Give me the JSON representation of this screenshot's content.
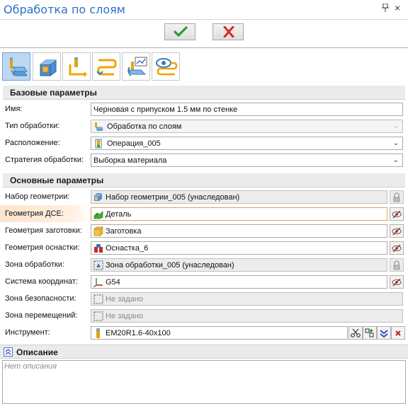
{
  "window": {
    "title": "Обработка по слоям",
    "pin_glyph": "ᵽ",
    "close_glyph": "×"
  },
  "actions": {
    "ok_icon": "checkmark-icon",
    "cancel_icon": "cross-icon",
    "ok_color": "#2e9a2e",
    "cancel_color": "#d62828"
  },
  "toolbar": {
    "buttons": [
      {
        "icon": "layers-mill-icon",
        "active": true
      },
      {
        "icon": "blank-block-icon",
        "active": false
      },
      {
        "icon": "approach-path-icon",
        "active": false
      },
      {
        "icon": "link-path-icon",
        "active": false
      },
      {
        "icon": "tool-params-icon",
        "active": false
      },
      {
        "icon": "visibility-path-icon",
        "active": false
      }
    ]
  },
  "basic_params": {
    "header": "Базовые параметры",
    "name_label": "Имя:",
    "name_value": "Черновая с припуском 1.5 мм по стенке",
    "type_label": "Тип обработки:",
    "type_value": "Обработка по слоям",
    "location_label": "Расположение:",
    "location_value": "Операция_005",
    "strategy_label": "Стратегия обработки:",
    "strategy_value": "Выборка материала"
  },
  "main_params": {
    "header": "Основные параметры",
    "geometry_set_label": "Набор геометрии:",
    "geometry_set_value": "Набор геометрии_005 (унаследован)",
    "part_geometry_label": "Геометрия ДСЕ:",
    "part_geometry_value": "Деталь",
    "stock_geometry_label": "Геометрия заготовки:",
    "stock_geometry_value": "Заготовка",
    "fixture_geometry_label": "Геометрия оснастки:",
    "fixture_geometry_value": "Оснастка_6",
    "machining_zone_label": "Зона обработки:",
    "machining_zone_value": "Зона обработки_005 (унаследован)",
    "coord_system_label": "Система координат:",
    "coord_system_value": "G54",
    "safety_zone_label": "Зона безопасности:",
    "safety_zone_value": "Не задано",
    "travel_zone_label": "Зона перемещений:",
    "travel_zone_value": "Не задано",
    "tool_label": "Инструмент:",
    "tool_value": "EM20R1.6-40x100"
  },
  "description": {
    "header": "Описание",
    "placeholder": "Нет описания"
  }
}
